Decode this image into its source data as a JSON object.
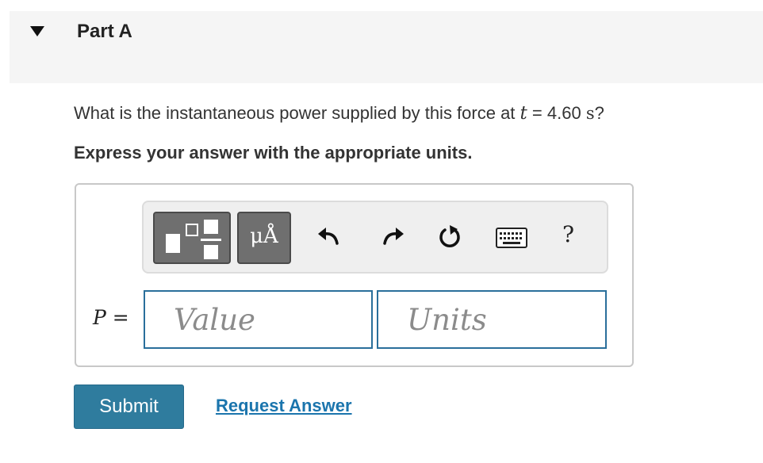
{
  "part": {
    "title": "Part A",
    "collapse_icon": "caret-down-icon"
  },
  "question": {
    "prefix": "What is the instantaneous power supplied by this force at ",
    "variable": "t",
    "equals": " = 4.60 ",
    "unit": "s",
    "suffix": "?"
  },
  "instruction": "Express your answer with the appropriate units.",
  "toolbar": {
    "templates_icon": "templates-fraction-icon",
    "units_glyph": "μÅ",
    "undo_icon": "undo-icon",
    "redo_icon": "redo-icon",
    "reset_icon": "reset-icon",
    "keyboard_icon": "keyboard-icon",
    "help_label": "?"
  },
  "answer": {
    "variable": "P",
    "equals": " =",
    "value_placeholder": "Value",
    "value": "",
    "units_placeholder": "Units",
    "units": ""
  },
  "actions": {
    "submit_label": "Submit",
    "request_answer_label": "Request Answer"
  },
  "colors": {
    "submit_bg": "#2f7c9e",
    "link": "#1b75ad",
    "input_border": "#2a6f9b",
    "toolbar_button": "#6f6f6f"
  }
}
